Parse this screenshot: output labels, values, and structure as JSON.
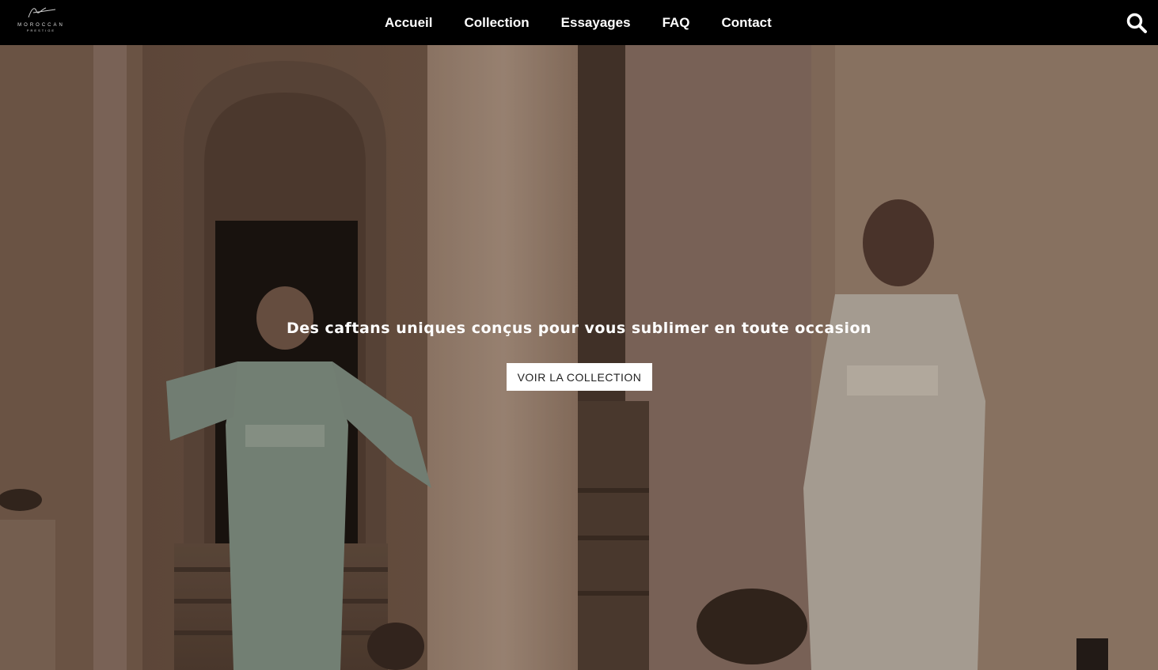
{
  "brand": {
    "name": "MOROCCAN",
    "tagline": "PRESTIGE"
  },
  "nav": {
    "items": [
      {
        "label": "Accueil"
      },
      {
        "label": "Collection"
      },
      {
        "label": "Essayages"
      },
      {
        "label": "FAQ"
      },
      {
        "label": "Contact"
      }
    ]
  },
  "header_icons": {
    "search": "search-icon"
  },
  "hero": {
    "headline": "Des caftans uniques conçus pour vous sublimer en toute occasion",
    "cta_label": "VOIR LA COLLECTION"
  },
  "colors": {
    "header_bg": "#000000",
    "cta_bg": "#ffffff",
    "cta_text": "#222222"
  }
}
